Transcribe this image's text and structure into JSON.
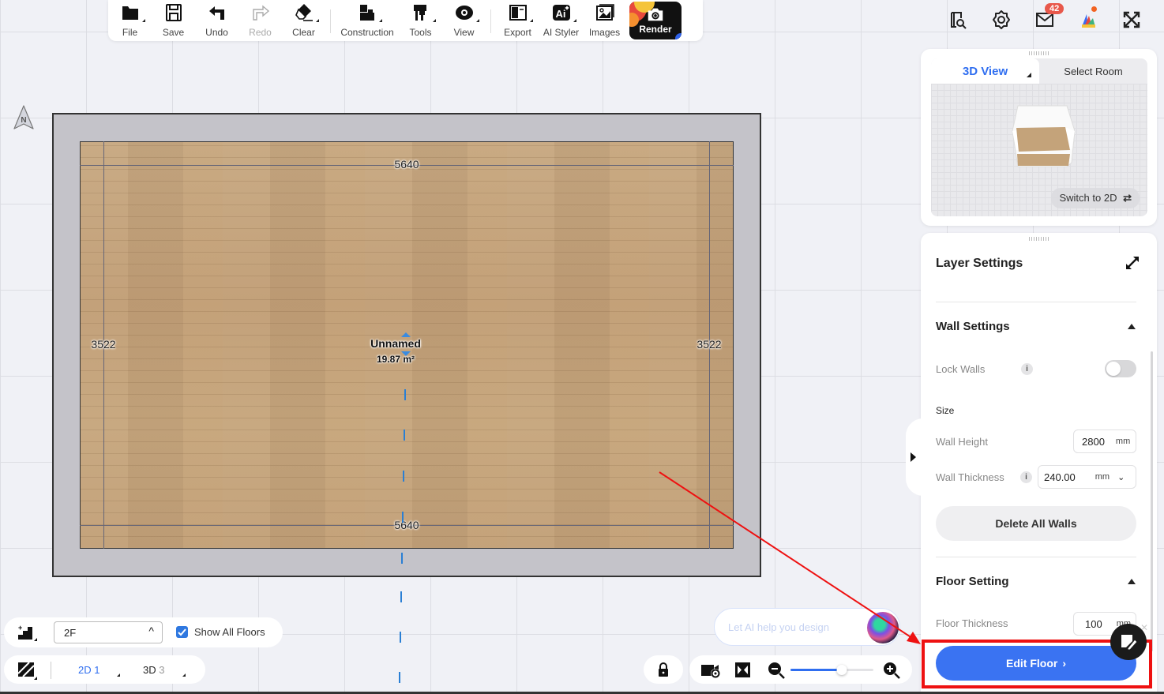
{
  "toolbar": {
    "items": [
      {
        "label": "File",
        "icon": "folder-icon"
      },
      {
        "label": "Save",
        "icon": "save-icon"
      },
      {
        "label": "Undo",
        "icon": "undo-icon"
      },
      {
        "label": "Redo",
        "icon": "redo-icon",
        "disabled": true
      },
      {
        "label": "Clear",
        "icon": "eraser-icon"
      },
      {
        "label": "Construction",
        "icon": "construction-icon"
      },
      {
        "label": "Tools",
        "icon": "tools-icon"
      },
      {
        "label": "View",
        "icon": "eye-icon"
      },
      {
        "label": "Export",
        "icon": "export-icon"
      },
      {
        "label": "AI Styler",
        "icon": "ai-styler-icon"
      },
      {
        "label": "Images",
        "icon": "image-icon"
      }
    ],
    "render_label": "Render"
  },
  "top_right": {
    "messages_badge": "42",
    "icons": [
      "catalog-search-icon",
      "settings-icon",
      "mail-icon",
      "brand-icon",
      "fullscreen-icon"
    ]
  },
  "compass": {
    "label": "N"
  },
  "canvas": {
    "room_name": "Unnamed",
    "room_area": "19.87 m²",
    "dim_top": "5640",
    "dim_bottom": "5640",
    "dim_left": "3522",
    "dim_right": "3522"
  },
  "view3d": {
    "tab_active": "3D View",
    "tab_other": "Select Room",
    "switch_label": "Switch to 2D"
  },
  "layer_settings": {
    "title": "Layer Settings",
    "wall_section": "Wall Settings",
    "lock_walls_label": "Lock Walls",
    "lock_walls_on": false,
    "size_label": "Size",
    "wall_height_label": "Wall Height",
    "wall_height_value": "2800",
    "wall_height_unit": "mm",
    "wall_thickness_label": "Wall Thickness",
    "wall_thickness_value": "240.00",
    "wall_thickness_unit": "mm",
    "delete_walls_label": "Delete All Walls",
    "floor_section": "Floor Setting",
    "floor_thickness_label": "Floor Thickness",
    "floor_thickness_value": "100",
    "floor_thickness_unit": "mm",
    "edit_floor_label": "Edit Floor"
  },
  "bottom_left": {
    "floor_value": "2F",
    "show_all_floors_label": "Show All Floors",
    "show_all_floors_checked": true,
    "view_2d_label": "2D",
    "view_2d_count": "1",
    "view_3d_label": "3D",
    "view_3d_count": "3"
  },
  "bottom_right": {
    "ai_placeholder": "Let AI help you design",
    "zoom_level": 0.62
  },
  "colors": {
    "accent": "#2f6ef0",
    "edit_floor_bg": "#3a73f2",
    "highlight": "#ee1111",
    "badge": "#e8584b"
  }
}
